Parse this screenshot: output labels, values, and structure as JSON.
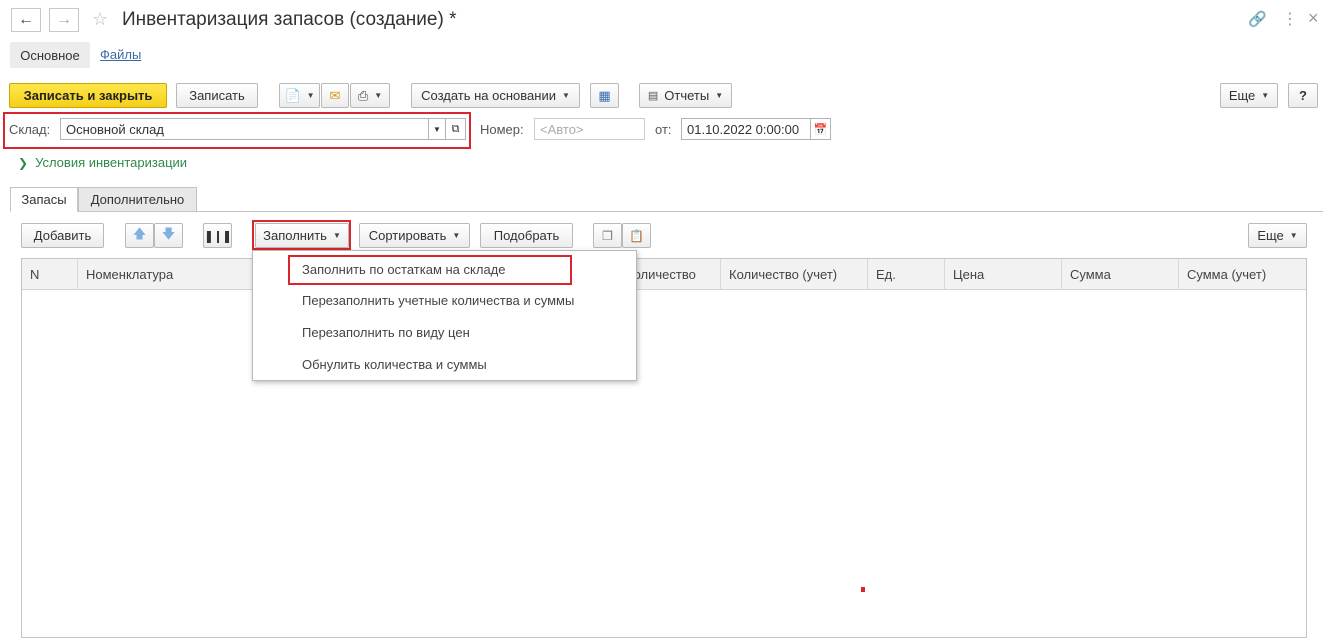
{
  "header": {
    "title": "Инвентаризация запасов (создание) *",
    "back_icon": "arrow-left-icon",
    "forward_icon": "arrow-right-icon",
    "star_icon": "star-icon",
    "window_icons": [
      "link-icon",
      "more-vertical-icon",
      "close-icon"
    ]
  },
  "nav": {
    "main_tab": "Основное",
    "files_link": "Файлы"
  },
  "toolbar": {
    "save_close": "Записать и закрыть",
    "save": "Записать",
    "create_based_on": "Создать на основании",
    "reports": "Отчеты",
    "more": "Еще",
    "help": "?"
  },
  "form": {
    "warehouse_label": "Склад:",
    "warehouse_value": "Основной склад",
    "number_label": "Номер:",
    "number_placeholder": "<Авто>",
    "date_label": "от:",
    "date_value": "01.10.2022  0:00:00",
    "conditions_link": "Условия инвентаризации"
  },
  "tabs": {
    "stocks": "Запасы",
    "additional": "Дополнительно"
  },
  "table_toolbar": {
    "add": "Добавить",
    "fill": "Заполнить",
    "sort": "Сортировать",
    "pick": "Подобрать",
    "more": "Еще"
  },
  "fill_menu": {
    "items": [
      "Заполнить по остаткам на складе",
      "Перезаполнить учетные количества и суммы",
      "Перезаполнить по виду цен",
      "Обнулить количества и суммы"
    ]
  },
  "table": {
    "columns": [
      "N",
      "Номенклатура",
      "Количество",
      "Количество (учет)",
      "Ед.",
      "Цена",
      "Сумма",
      "Сумма (учет)"
    ],
    "rows": []
  },
  "colors": {
    "accent_yellow": "#f5cf1c",
    "highlight_red": "#d9262c",
    "link_blue": "#3c6aa5",
    "link_green": "#2f8a4b"
  }
}
